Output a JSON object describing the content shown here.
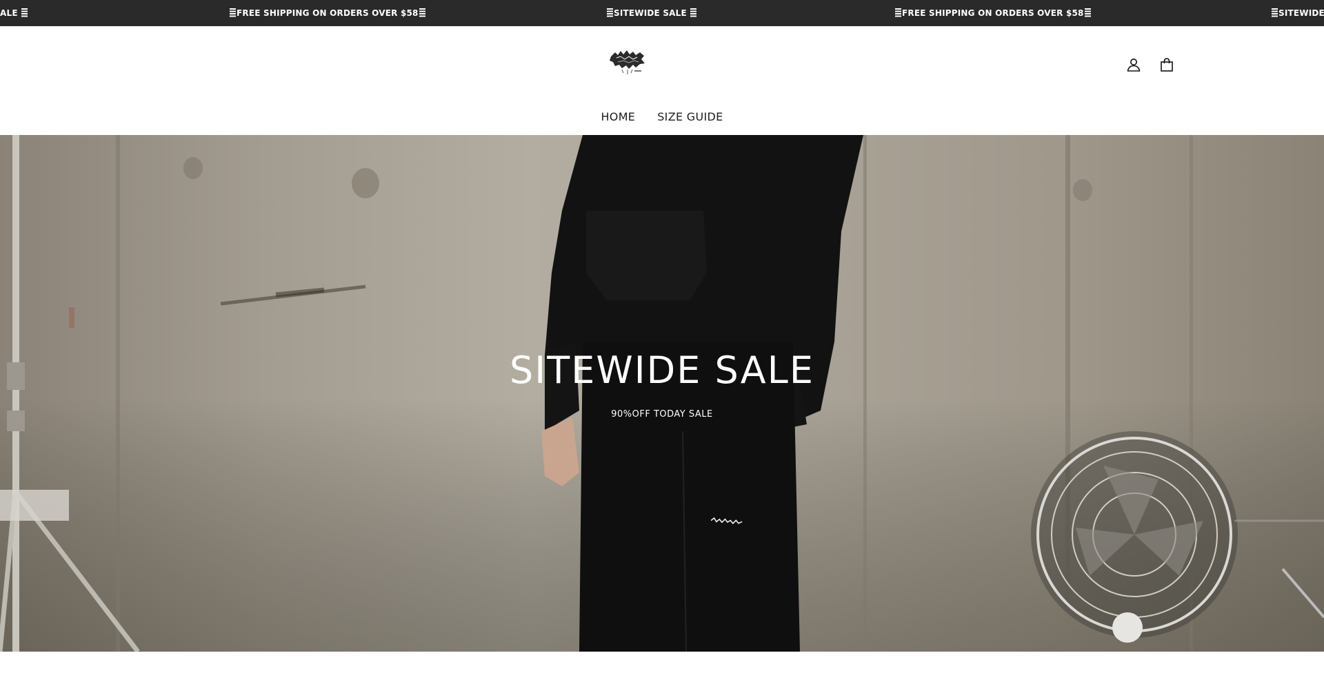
{
  "announcement": {
    "items": [
      {
        "text": "ALE",
        "bars_before": false,
        "bars_after": true
      },
      {
        "text": "FREE SHIPPING ON ORDERS OVER $58",
        "bars_before": true,
        "bars_after": true
      },
      {
        "text": "SITEWIDE SALE",
        "bars_before": true,
        "bars_after": true
      },
      {
        "text": "FREE SHIPPING ON ORDERS OVER $58",
        "bars_before": true,
        "bars_after": true
      },
      {
        "text": "SITEWIDE S",
        "bars_before": true,
        "bars_after": false
      }
    ],
    "background": "#2a2a2a",
    "text_color": "#ffffff"
  },
  "header": {
    "logo_icon": "brand-logo",
    "account_icon": "account-icon",
    "cart_icon": "cart-icon"
  },
  "nav": {
    "items": [
      {
        "label": "HOME"
      },
      {
        "label": "SIZE GUIDE"
      }
    ]
  },
  "hero": {
    "title": "SITEWIDE SALE",
    "subtitle": "90%OFF TODAY SALE"
  }
}
